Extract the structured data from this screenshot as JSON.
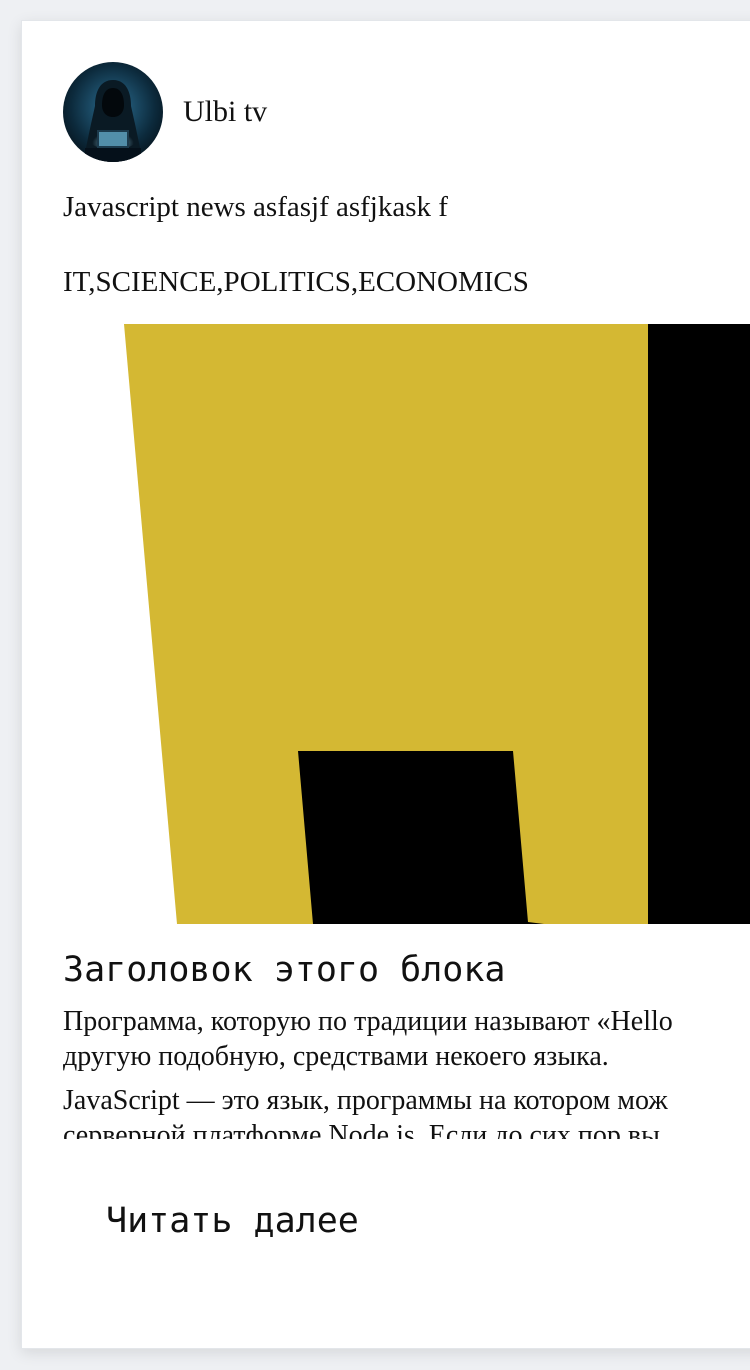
{
  "author": {
    "name": "Ulbi tv",
    "avatar_icon": "hooded-hacker-avatar"
  },
  "post": {
    "subtitle": "Javascript news asfasjf asfjkask f",
    "tags": "IT,SCIENCE,POLITICS,ECONOMICS",
    "image_icon": "javascript-logo",
    "block_title": "Заголовок этого блока",
    "paragraph_1": "Программа, которую по традиции называют «Hello",
    "paragraph_1b": "другую подобную, средствами некоего языка.",
    "paragraph_2": "JavaScript — это язык, программы на котором мож",
    "paragraph_2b": "серверной платформе Node.js. Если до сих пор вы",
    "read_more_label": "Читать далее"
  },
  "colors": {
    "js_yellow": "#d4b833",
    "js_black": "#000000",
    "card_bg": "#ffffff"
  }
}
